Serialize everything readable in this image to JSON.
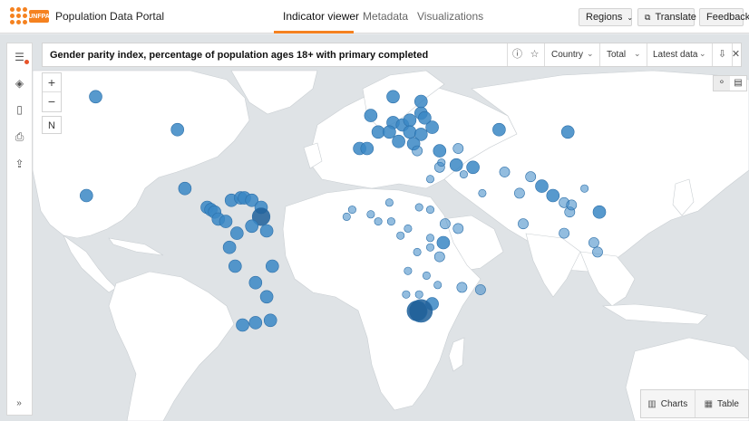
{
  "header": {
    "portal_title": "Population Data Portal",
    "logo_text": "UNFPA",
    "tabs": [
      {
        "label": "Indicator viewer",
        "active": true
      },
      {
        "label": "Metadata",
        "active": false
      },
      {
        "label": "Visualizations",
        "active": false
      }
    ],
    "regions_label": "Regions",
    "translate_label": "Translate",
    "feedback_label": "Feedback",
    "accent_color": "#f58220"
  },
  "indicator": {
    "title": "Gender parity index, percentage of population ages 18+ with primary completed",
    "country_label": "Country",
    "total_label": "Total",
    "latest_label": "Latest data",
    "icons": [
      "info-icon",
      "star-icon",
      "download-icon",
      "close-icon"
    ]
  },
  "map": {
    "zoom_in": "+",
    "zoom_out": "−",
    "compass": "N",
    "land_color": "#ffffff",
    "water_color": "#dfe3e6",
    "bubble_color": "#3a87c4",
    "bubble_dark": "#1f5f99",
    "bubbles": [
      {
        "lon": -150,
        "lat": 62,
        "v": 1.0
      },
      {
        "lon": -106,
        "lat": 48,
        "v": 1.0
      },
      {
        "lon": -155,
        "lat": 20,
        "v": 1.0
      },
      {
        "lon": -102,
        "lat": 23,
        "v": 1.0
      },
      {
        "lon": -90,
        "lat": 15,
        "v": 1.0
      },
      {
        "lon": -88,
        "lat": 14,
        "v": 1.0
      },
      {
        "lon": -86,
        "lat": 13,
        "v": 1.0
      },
      {
        "lon": -84,
        "lat": 10,
        "v": 1.0
      },
      {
        "lon": -80,
        "lat": 9,
        "v": 1.0
      },
      {
        "lon": -77,
        "lat": 18,
        "v": 1.0
      },
      {
        "lon": -72,
        "lat": 19,
        "v": 1.0
      },
      {
        "lon": -70,
        "lat": 19,
        "v": 1.0
      },
      {
        "lon": -66,
        "lat": 18,
        "v": 1.0
      },
      {
        "lon": -61,
        "lat": 15,
        "v": 1.0
      },
      {
        "lon": -61,
        "lat": 11,
        "v": 1.4
      },
      {
        "lon": -74,
        "lat": 4,
        "v": 1.0
      },
      {
        "lon": -66,
        "lat": 7,
        "v": 1.0
      },
      {
        "lon": -58,
        "lat": 5,
        "v": 1.0
      },
      {
        "lon": -78,
        "lat": -2,
        "v": 1.0
      },
      {
        "lon": -55,
        "lat": -10,
        "v": 1.0
      },
      {
        "lon": -75,
        "lat": -10,
        "v": 1.0
      },
      {
        "lon": -64,
        "lat": -17,
        "v": 1.0
      },
      {
        "lon": -58,
        "lat": -23,
        "v": 1.0
      },
      {
        "lon": -56,
        "lat": -33,
        "v": 1.0
      },
      {
        "lon": -64,
        "lat": -34,
        "v": 1.0
      },
      {
        "lon": -71,
        "lat": -35,
        "v": 1.0
      },
      {
        "lon": -2,
        "lat": 54,
        "v": 1.0
      },
      {
        "lon": 2,
        "lat": 47,
        "v": 1.0
      },
      {
        "lon": 10,
        "lat": 51,
        "v": 1.0
      },
      {
        "lon": 8,
        "lat": 47,
        "v": 1.0
      },
      {
        "lon": 15,
        "lat": 50,
        "v": 1.0
      },
      {
        "lon": 19,
        "lat": 52,
        "v": 1.0
      },
      {
        "lon": 19,
        "lat": 47,
        "v": 1.0
      },
      {
        "lon": 25,
        "lat": 46,
        "v": 1.0
      },
      {
        "lon": 31,
        "lat": 49,
        "v": 1.0
      },
      {
        "lon": 25,
        "lat": 55,
        "v": 1.0
      },
      {
        "lon": 25,
        "lat": 60,
        "v": 1.0
      },
      {
        "lon": 27,
        "lat": 53,
        "v": 1.0
      },
      {
        "lon": 10,
        "lat": 62,
        "v": 1.0
      },
      {
        "lon": -8,
        "lat": 40,
        "v": 1.0
      },
      {
        "lon": -4,
        "lat": 40,
        "v": 1.0
      },
      {
        "lon": 13,
        "lat": 43,
        "v": 1.0
      },
      {
        "lon": 21,
        "lat": 42,
        "v": 1.0
      },
      {
        "lon": 23,
        "lat": 39,
        "v": 0.8
      },
      {
        "lon": 35,
        "lat": 39,
        "v": 1.0
      },
      {
        "lon": 45,
        "lat": 40,
        "v": 0.8
      },
      {
        "lon": 53,
        "lat": 32,
        "v": 1.0
      },
      {
        "lon": 67,
        "lat": 48,
        "v": 1.0
      },
      {
        "lon": 104,
        "lat": 47,
        "v": 1.0
      },
      {
        "lon": 44,
        "lat": 33,
        "v": 1.0
      },
      {
        "lon": 35,
        "lat": 32,
        "v": 0.8
      },
      {
        "lon": 36,
        "lat": 34,
        "v": 0.6
      },
      {
        "lon": 30,
        "lat": 27,
        "v": 0.6
      },
      {
        "lon": 48,
        "lat": 29,
        "v": 0.6
      },
      {
        "lon": 58,
        "lat": 21,
        "v": 0.6
      },
      {
        "lon": 70,
        "lat": 30,
        "v": 0.8
      },
      {
        "lon": 84,
        "lat": 28,
        "v": 0.8
      },
      {
        "lon": 90,
        "lat": 24,
        "v": 1.0
      },
      {
        "lon": 78,
        "lat": 21,
        "v": 0.8
      },
      {
        "lon": 80,
        "lat": 8,
        "v": 0.8
      },
      {
        "lon": 96,
        "lat": 20,
        "v": 1.0
      },
      {
        "lon": 102,
        "lat": 17,
        "v": 0.8
      },
      {
        "lon": 105,
        "lat": 13,
        "v": 0.8
      },
      {
        "lon": 106,
        "lat": 16,
        "v": 0.8
      },
      {
        "lon": 102,
        "lat": 4,
        "v": 0.8
      },
      {
        "lon": 121,
        "lat": 13,
        "v": 1.0
      },
      {
        "lon": 118,
        "lat": 0,
        "v": 0.8
      },
      {
        "lon": 120,
        "lat": -4,
        "v": 0.8
      },
      {
        "lon": 113,
        "lat": 23,
        "v": 0.6
      },
      {
        "lon": -12,
        "lat": 14,
        "v": 0.6
      },
      {
        "lon": -15,
        "lat": 11,
        "v": 0.6
      },
      {
        "lon": -2,
        "lat": 12,
        "v": 0.6
      },
      {
        "lon": 2,
        "lat": 9,
        "v": 0.6
      },
      {
        "lon": 9,
        "lat": 9,
        "v": 0.6
      },
      {
        "lon": 18,
        "lat": 6,
        "v": 0.6
      },
      {
        "lon": 8,
        "lat": 17,
        "v": 0.6
      },
      {
        "lon": 14,
        "lat": 3,
        "v": 0.6
      },
      {
        "lon": 24,
        "lat": 15,
        "v": 0.6
      },
      {
        "lon": 30,
        "lat": 14,
        "v": 0.6
      },
      {
        "lon": 38,
        "lat": 8,
        "v": 0.8
      },
      {
        "lon": 45,
        "lat": 6,
        "v": 0.8
      },
      {
        "lon": 30,
        "lat": 2,
        "v": 0.6
      },
      {
        "lon": 37,
        "lat": 0,
        "v": 1.0
      },
      {
        "lon": 30,
        "lat": -2,
        "v": 0.6
      },
      {
        "lon": 35,
        "lat": -6,
        "v": 0.8
      },
      {
        "lon": 23,
        "lat": -4,
        "v": 0.6
      },
      {
        "lon": 18,
        "lat": -12,
        "v": 0.6
      },
      {
        "lon": 28,
        "lat": -14,
        "v": 0.6
      },
      {
        "lon": 34,
        "lat": -18,
        "v": 0.6
      },
      {
        "lon": 24,
        "lat": -22,
        "v": 0.6
      },
      {
        "lon": 17,
        "lat": -22,
        "v": 0.6
      },
      {
        "lon": 31,
        "lat": -26,
        "v": 1.0
      },
      {
        "lon": 47,
        "lat": -19,
        "v": 0.8
      },
      {
        "lon": 57,
        "lat": -20,
        "v": 0.8
      },
      {
        "lon": 25,
        "lat": -29,
        "v": 1.8
      },
      {
        "lon": 23,
        "lat": -29,
        "v": 1.6
      }
    ]
  },
  "toolbar": {
    "items": [
      "layers-list-icon",
      "layers-icon",
      "bookmark-icon",
      "print-icon",
      "export-icon"
    ],
    "expand": "»"
  },
  "bottom": {
    "charts_label": "Charts",
    "table_label": "Table"
  }
}
